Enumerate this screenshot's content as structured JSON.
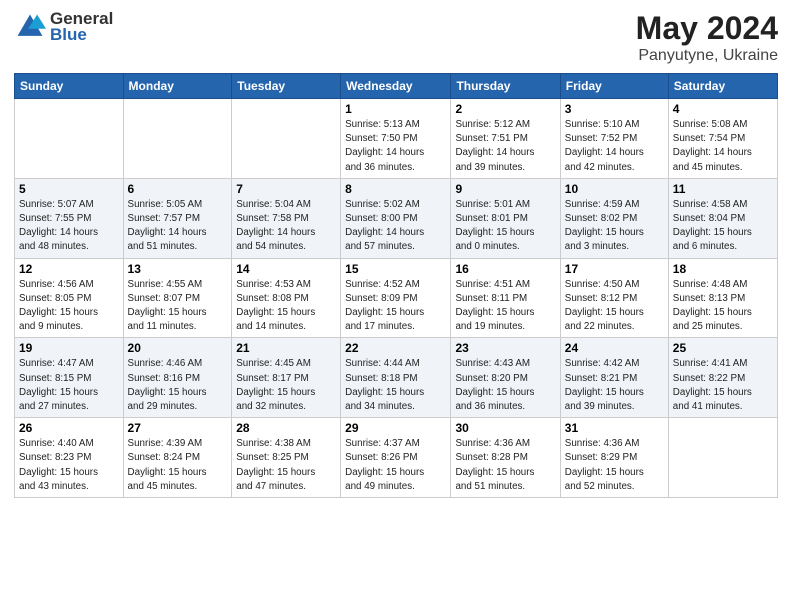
{
  "header": {
    "logo_general": "General",
    "logo_blue": "Blue",
    "month": "May 2024",
    "location": "Panyutyne, Ukraine"
  },
  "days_of_week": [
    "Sunday",
    "Monday",
    "Tuesday",
    "Wednesday",
    "Thursday",
    "Friday",
    "Saturday"
  ],
  "weeks": [
    [
      {
        "day": "",
        "info": ""
      },
      {
        "day": "",
        "info": ""
      },
      {
        "day": "",
        "info": ""
      },
      {
        "day": "1",
        "info": "Sunrise: 5:13 AM\nSunset: 7:50 PM\nDaylight: 14 hours\nand 36 minutes."
      },
      {
        "day": "2",
        "info": "Sunrise: 5:12 AM\nSunset: 7:51 PM\nDaylight: 14 hours\nand 39 minutes."
      },
      {
        "day": "3",
        "info": "Sunrise: 5:10 AM\nSunset: 7:52 PM\nDaylight: 14 hours\nand 42 minutes."
      },
      {
        "day": "4",
        "info": "Sunrise: 5:08 AM\nSunset: 7:54 PM\nDaylight: 14 hours\nand 45 minutes."
      }
    ],
    [
      {
        "day": "5",
        "info": "Sunrise: 5:07 AM\nSunset: 7:55 PM\nDaylight: 14 hours\nand 48 minutes."
      },
      {
        "day": "6",
        "info": "Sunrise: 5:05 AM\nSunset: 7:57 PM\nDaylight: 14 hours\nand 51 minutes."
      },
      {
        "day": "7",
        "info": "Sunrise: 5:04 AM\nSunset: 7:58 PM\nDaylight: 14 hours\nand 54 minutes."
      },
      {
        "day": "8",
        "info": "Sunrise: 5:02 AM\nSunset: 8:00 PM\nDaylight: 14 hours\nand 57 minutes."
      },
      {
        "day": "9",
        "info": "Sunrise: 5:01 AM\nSunset: 8:01 PM\nDaylight: 15 hours\nand 0 minutes."
      },
      {
        "day": "10",
        "info": "Sunrise: 4:59 AM\nSunset: 8:02 PM\nDaylight: 15 hours\nand 3 minutes."
      },
      {
        "day": "11",
        "info": "Sunrise: 4:58 AM\nSunset: 8:04 PM\nDaylight: 15 hours\nand 6 minutes."
      }
    ],
    [
      {
        "day": "12",
        "info": "Sunrise: 4:56 AM\nSunset: 8:05 PM\nDaylight: 15 hours\nand 9 minutes."
      },
      {
        "day": "13",
        "info": "Sunrise: 4:55 AM\nSunset: 8:07 PM\nDaylight: 15 hours\nand 11 minutes."
      },
      {
        "day": "14",
        "info": "Sunrise: 4:53 AM\nSunset: 8:08 PM\nDaylight: 15 hours\nand 14 minutes."
      },
      {
        "day": "15",
        "info": "Sunrise: 4:52 AM\nSunset: 8:09 PM\nDaylight: 15 hours\nand 17 minutes."
      },
      {
        "day": "16",
        "info": "Sunrise: 4:51 AM\nSunset: 8:11 PM\nDaylight: 15 hours\nand 19 minutes."
      },
      {
        "day": "17",
        "info": "Sunrise: 4:50 AM\nSunset: 8:12 PM\nDaylight: 15 hours\nand 22 minutes."
      },
      {
        "day": "18",
        "info": "Sunrise: 4:48 AM\nSunset: 8:13 PM\nDaylight: 15 hours\nand 25 minutes."
      }
    ],
    [
      {
        "day": "19",
        "info": "Sunrise: 4:47 AM\nSunset: 8:15 PM\nDaylight: 15 hours\nand 27 minutes."
      },
      {
        "day": "20",
        "info": "Sunrise: 4:46 AM\nSunset: 8:16 PM\nDaylight: 15 hours\nand 29 minutes."
      },
      {
        "day": "21",
        "info": "Sunrise: 4:45 AM\nSunset: 8:17 PM\nDaylight: 15 hours\nand 32 minutes."
      },
      {
        "day": "22",
        "info": "Sunrise: 4:44 AM\nSunset: 8:18 PM\nDaylight: 15 hours\nand 34 minutes."
      },
      {
        "day": "23",
        "info": "Sunrise: 4:43 AM\nSunset: 8:20 PM\nDaylight: 15 hours\nand 36 minutes."
      },
      {
        "day": "24",
        "info": "Sunrise: 4:42 AM\nSunset: 8:21 PM\nDaylight: 15 hours\nand 39 minutes."
      },
      {
        "day": "25",
        "info": "Sunrise: 4:41 AM\nSunset: 8:22 PM\nDaylight: 15 hours\nand 41 minutes."
      }
    ],
    [
      {
        "day": "26",
        "info": "Sunrise: 4:40 AM\nSunset: 8:23 PM\nDaylight: 15 hours\nand 43 minutes."
      },
      {
        "day": "27",
        "info": "Sunrise: 4:39 AM\nSunset: 8:24 PM\nDaylight: 15 hours\nand 45 minutes."
      },
      {
        "day": "28",
        "info": "Sunrise: 4:38 AM\nSunset: 8:25 PM\nDaylight: 15 hours\nand 47 minutes."
      },
      {
        "day": "29",
        "info": "Sunrise: 4:37 AM\nSunset: 8:26 PM\nDaylight: 15 hours\nand 49 minutes."
      },
      {
        "day": "30",
        "info": "Sunrise: 4:36 AM\nSunset: 8:28 PM\nDaylight: 15 hours\nand 51 minutes."
      },
      {
        "day": "31",
        "info": "Sunrise: 4:36 AM\nSunset: 8:29 PM\nDaylight: 15 hours\nand 52 minutes."
      },
      {
        "day": "",
        "info": ""
      }
    ]
  ]
}
